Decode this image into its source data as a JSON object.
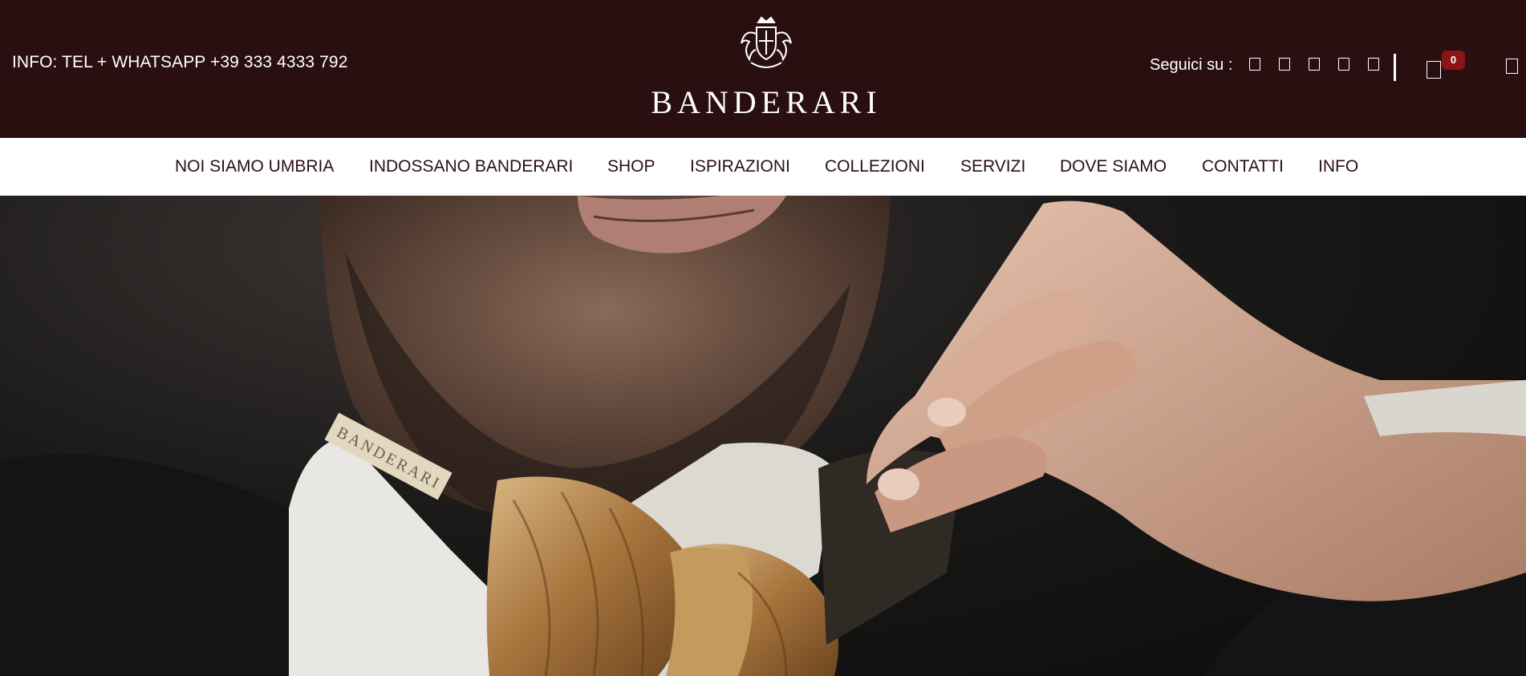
{
  "header": {
    "info": "INFO: TEL + WHATSAPP +39 333 4333 792",
    "brand": "BANDERARI",
    "follow_label": "Seguici su :",
    "social_icons": [
      "facebook-icon",
      "instagram-icon",
      "pinterest-icon",
      "youtube-icon",
      "linkedin-icon"
    ],
    "cart_count": "0",
    "colors": {
      "header_bg": "#2a0f10",
      "badge": "#8b1414",
      "nav_text": "#2a0f10"
    }
  },
  "nav": {
    "items": [
      "NOI SIAMO UMBRIA",
      "INDOSSANO BANDERARI",
      "SHOP",
      "ISPIRAZIONI",
      "COLLEZIONI",
      "SERVIZI",
      "DOVE SIAMO",
      "CONTATTI",
      "INFO"
    ]
  },
  "hero": {
    "collar_label": "BANDERARI"
  }
}
